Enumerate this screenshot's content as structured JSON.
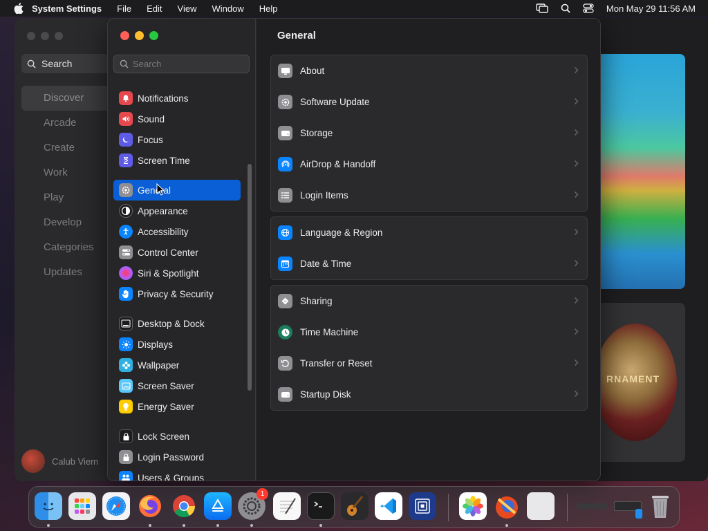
{
  "menubar": {
    "app_name": "System Settings",
    "menus": [
      "File",
      "Edit",
      "View",
      "Window",
      "Help"
    ],
    "clock": "Mon May 29  11:56 AM"
  },
  "background_app": {
    "search_label": "Search",
    "nav": [
      "Discover",
      "Arcade",
      "Create",
      "Work",
      "Play",
      "Develop",
      "Categories",
      "Updates"
    ],
    "selected": "Discover",
    "user_name": "Calub Viem",
    "emblem_text": "RNAMENT"
  },
  "settings": {
    "search_placeholder": "Search",
    "sidebar_groups": [
      [
        {
          "label": "Notifications",
          "icon": "bell-icon",
          "color": "#e5484d"
        },
        {
          "label": "Sound",
          "icon": "speaker-icon",
          "color": "#e5484d"
        },
        {
          "label": "Focus",
          "icon": "moon-icon",
          "color": "#5e5ce6"
        },
        {
          "label": "Screen Time",
          "icon": "hourglass-icon",
          "color": "#5e5ce6"
        }
      ],
      [
        {
          "label": "General",
          "icon": "gear-icon",
          "color": "#8e8e93"
        },
        {
          "label": "Appearance",
          "icon": "appearance-icon",
          "color": "#1c1c1e"
        },
        {
          "label": "Accessibility",
          "icon": "accessibility-icon",
          "color": "#0a84ff"
        },
        {
          "label": "Control Center",
          "icon": "toggles-icon",
          "color": "#8e8e93"
        },
        {
          "label": "Siri & Spotlight",
          "icon": "siri-icon",
          "color": "#bf5af2"
        },
        {
          "label": "Privacy & Security",
          "icon": "hand-icon",
          "color": "#0a84ff"
        }
      ],
      [
        {
          "label": "Desktop & Dock",
          "icon": "dock-icon",
          "color": "#1c1c1e"
        },
        {
          "label": "Displays",
          "icon": "sun-icon",
          "color": "#0a84ff"
        },
        {
          "label": "Wallpaper",
          "icon": "flower-icon",
          "color": "#30b0e0"
        },
        {
          "label": "Screen Saver",
          "icon": "screensaver-icon",
          "color": "#5ac8fa"
        },
        {
          "label": "Energy Saver",
          "icon": "bulb-icon",
          "color": "#ffcc00"
        }
      ],
      [
        {
          "label": "Lock Screen",
          "icon": "lock-icon",
          "color": "#1c1c1e"
        },
        {
          "label": "Login Password",
          "icon": "padlock-icon",
          "color": "#8e8e93"
        },
        {
          "label": "Users & Groups",
          "icon": "users-icon",
          "color": "#0a84ff"
        }
      ]
    ],
    "selected": "General",
    "page_title": "General",
    "sections": [
      [
        {
          "label": "About",
          "icon": "display-icon"
        },
        {
          "label": "Software Update",
          "icon": "update-gear-icon"
        },
        {
          "label": "Storage",
          "icon": "drive-icon"
        },
        {
          "label": "AirDrop & Handoff",
          "icon": "airdrop-icon"
        },
        {
          "label": "Login Items",
          "icon": "list-icon"
        }
      ],
      [
        {
          "label": "Language & Region",
          "icon": "globe-icon"
        },
        {
          "label": "Date & Time",
          "icon": "calendar-icon"
        }
      ],
      [
        {
          "label": "Sharing",
          "icon": "sharing-icon"
        },
        {
          "label": "Time Machine",
          "icon": "clock-icon"
        },
        {
          "label": "Transfer or Reset",
          "icon": "reset-icon"
        },
        {
          "label": "Startup Disk",
          "icon": "disk-icon"
        }
      ]
    ]
  },
  "dock": {
    "system_settings_badge": "1"
  }
}
